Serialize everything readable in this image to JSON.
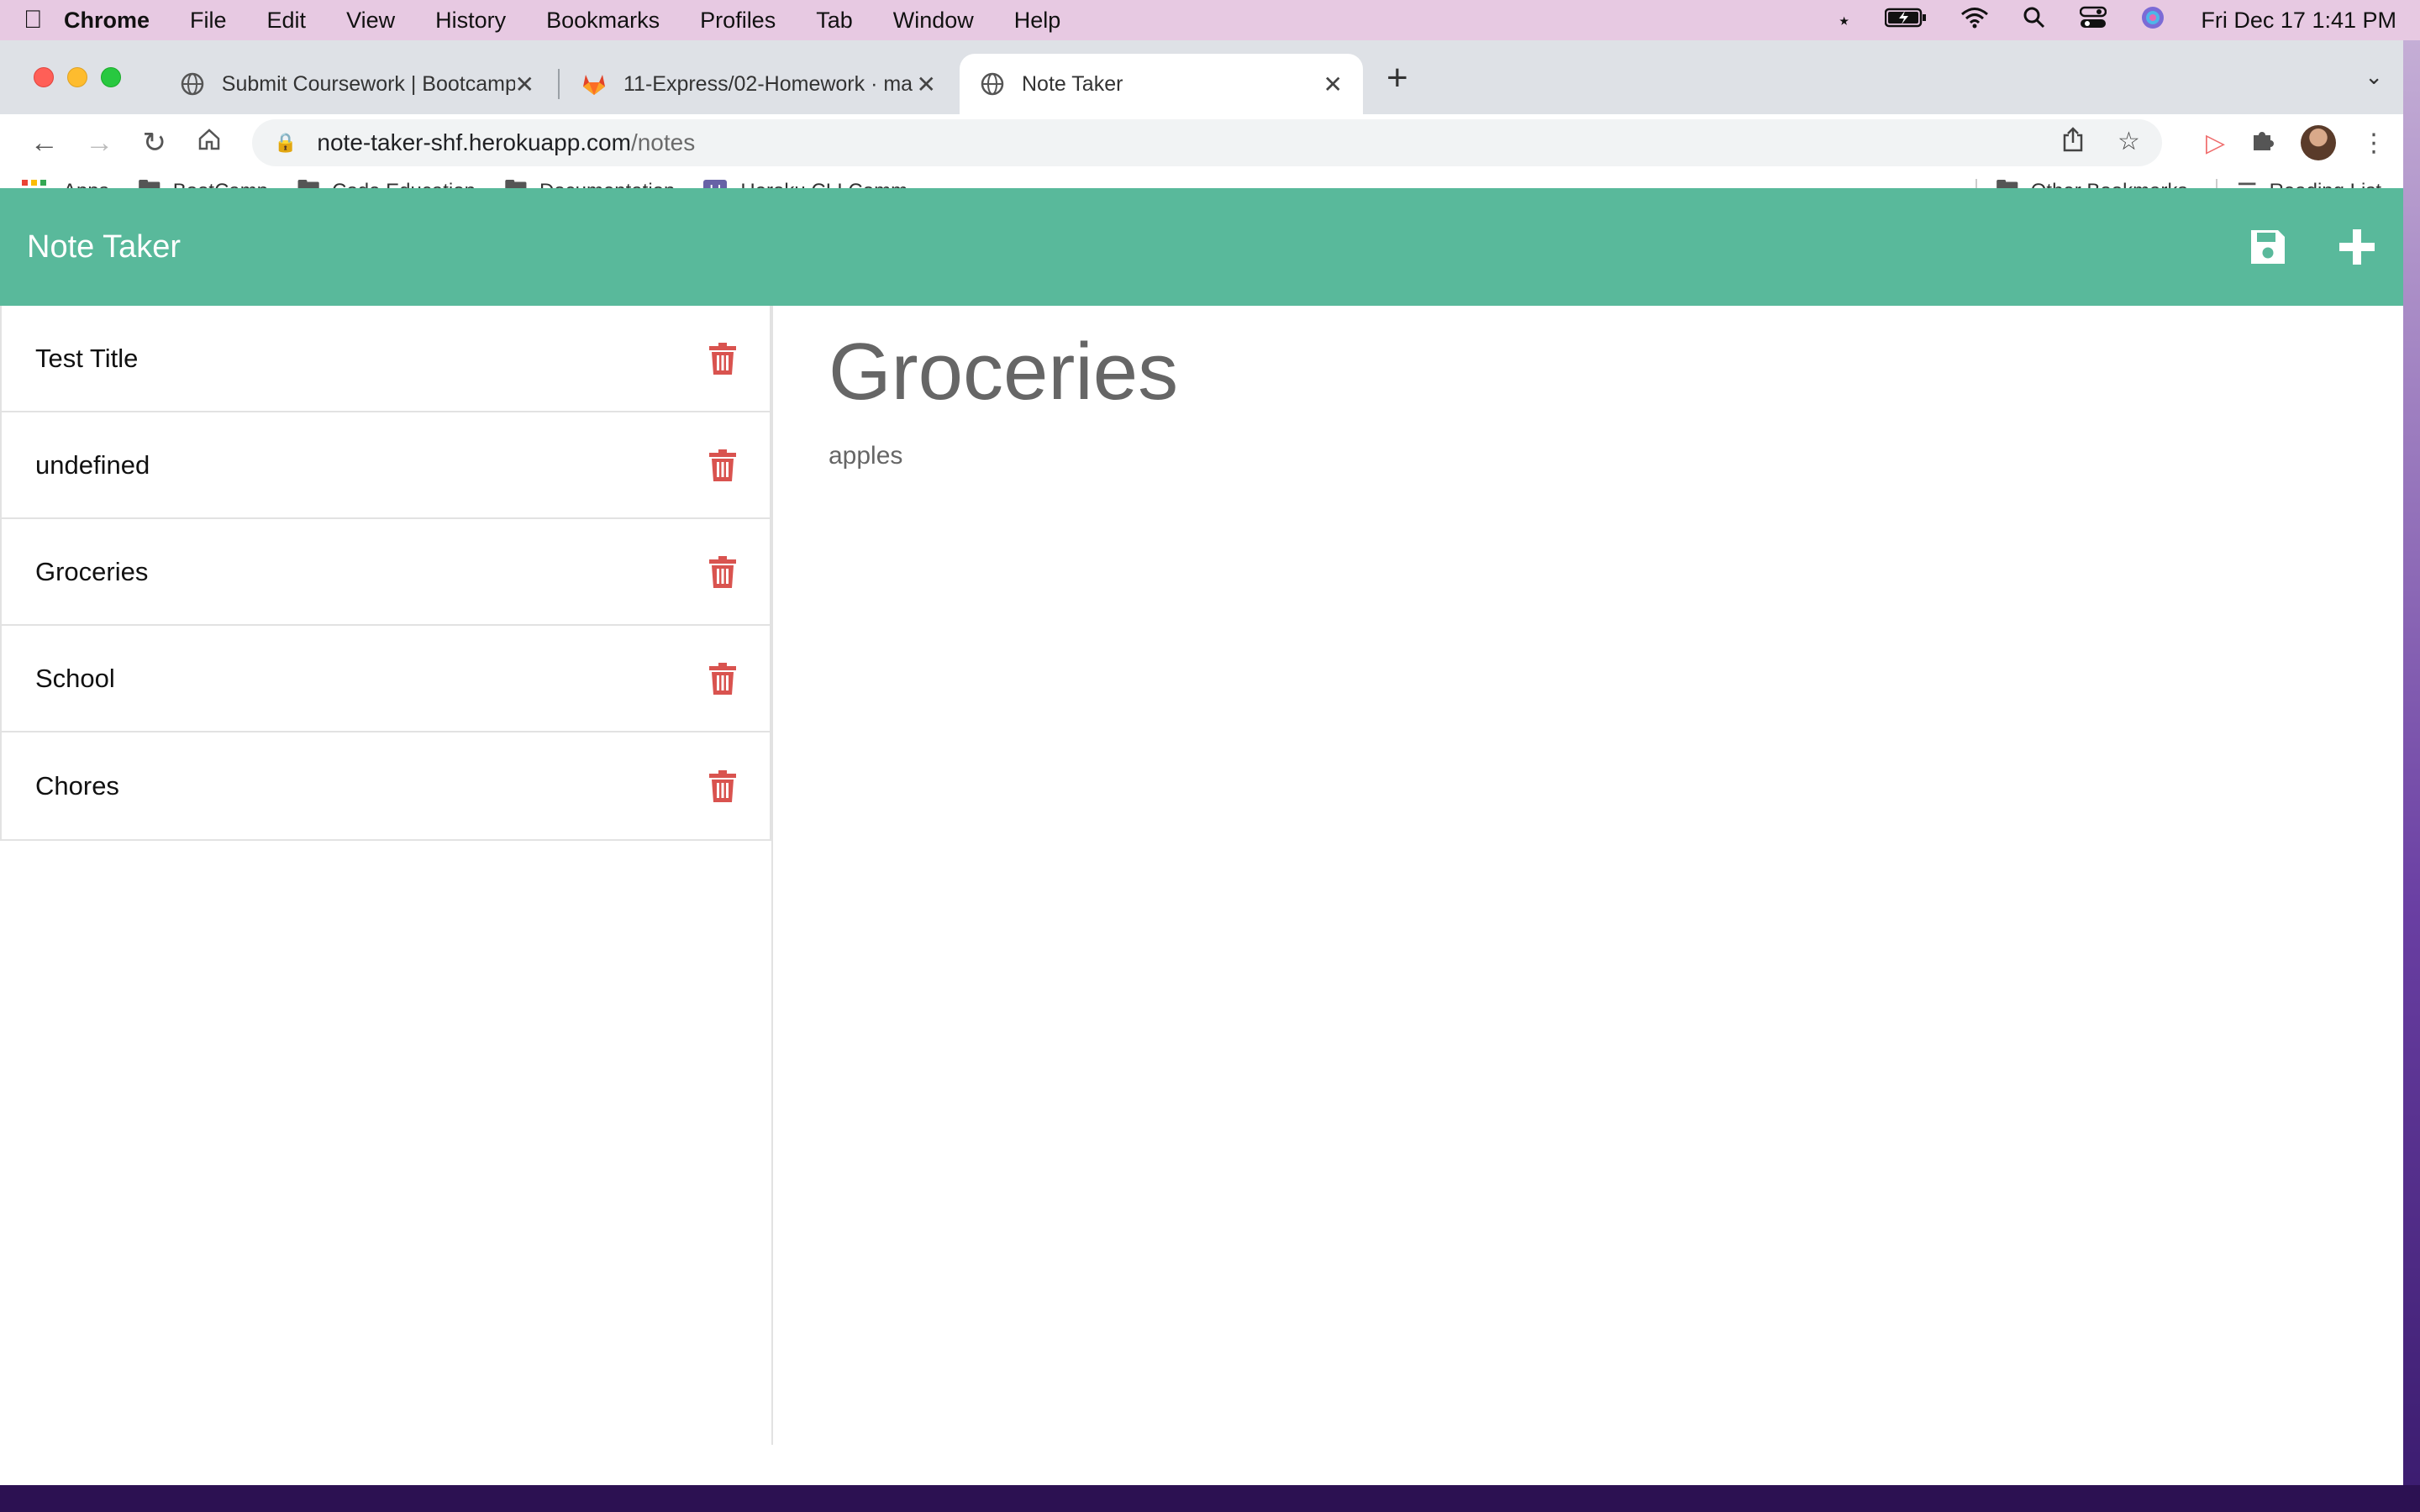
{
  "menubar": {
    "items": [
      "Chrome",
      "File",
      "Edit",
      "View",
      "History",
      "Bookmarks",
      "Profiles",
      "Tab",
      "Window",
      "Help"
    ],
    "clock": "Fri Dec 17  1:41 PM"
  },
  "tabs": [
    {
      "title": "Submit Coursework | Bootcamp",
      "icon": "globe-icon"
    },
    {
      "title": "11-Express/02-Homework · ma",
      "icon": "gitlab-icon"
    },
    {
      "title": "Note Taker",
      "icon": "globe-icon",
      "active": true
    }
  ],
  "address": {
    "host": "note-taker-shf.herokuapp.com",
    "path": "/notes"
  },
  "bookmarks": {
    "apps": "Apps",
    "items": [
      "BootCamp",
      "Code Education",
      "Documentation",
      "Heroku CLI Comm..."
    ],
    "other": "Other Bookmarks",
    "reading": "Reading List"
  },
  "app": {
    "brand": "Note Taker",
    "notes": [
      {
        "title": "Test Title"
      },
      {
        "title": "undefined"
      },
      {
        "title": "Groceries"
      },
      {
        "title": "School"
      },
      {
        "title": "Chores"
      }
    ],
    "active_note": {
      "title": "Groceries",
      "text": "apples"
    }
  },
  "colors": {
    "appbar": "#59b99b",
    "delete_icon": "#d9534f"
  }
}
